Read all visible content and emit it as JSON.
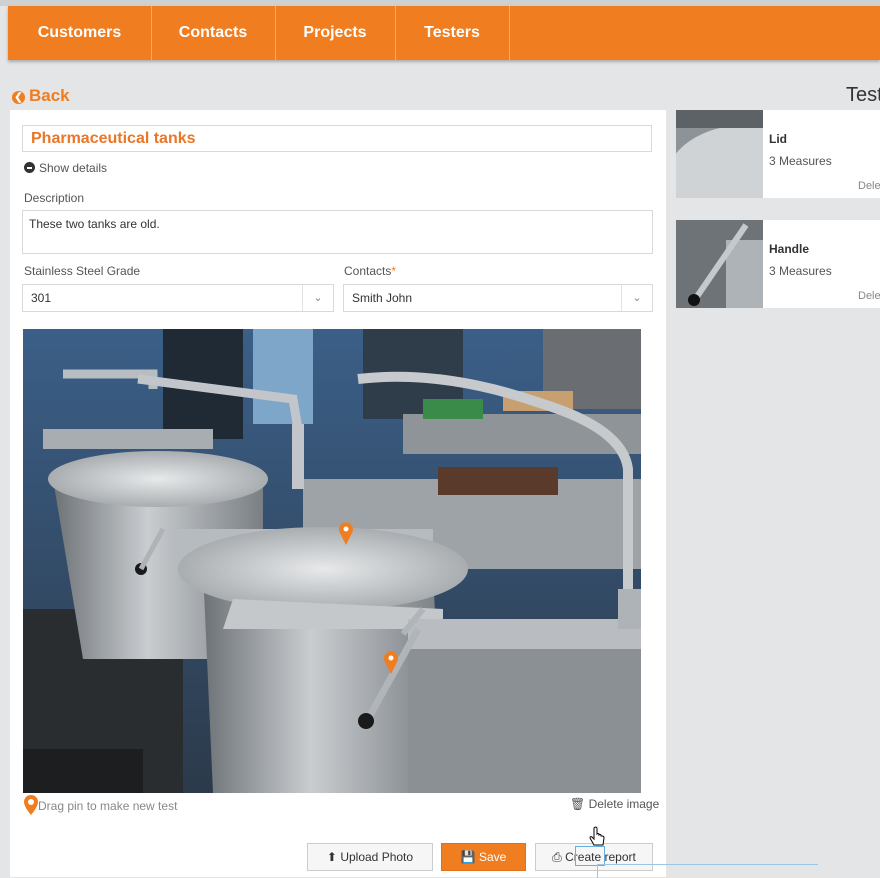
{
  "nav": {
    "tabs": [
      "Customers",
      "Contacts",
      "Projects",
      "Testers"
    ]
  },
  "back_label": "Back",
  "right_panel_title": "Test",
  "form": {
    "title_value": "Pharmaceutical tanks",
    "show_details": "Show details",
    "description_label": "Description",
    "description_value": "These two tanks are old.",
    "grade_label": "Stainless Steel Grade",
    "grade_value": "301",
    "contacts_label": "Contacts",
    "contacts_required": "*",
    "contacts_value": "Smith John"
  },
  "image_area": {
    "drag_hint": "Drag pin to make new test",
    "delete_image": "Delete image"
  },
  "actions": {
    "upload": "Upload Photo",
    "save": "Save",
    "report": "Create report"
  },
  "tests": [
    {
      "name": "Lid",
      "measures": "3 Measures",
      "delete": "Dele"
    },
    {
      "name": "Handle",
      "measures": "3 Measures",
      "delete": "Dele"
    }
  ],
  "colors": {
    "accent": "#f07d1f",
    "background": "#e4e5e6"
  }
}
